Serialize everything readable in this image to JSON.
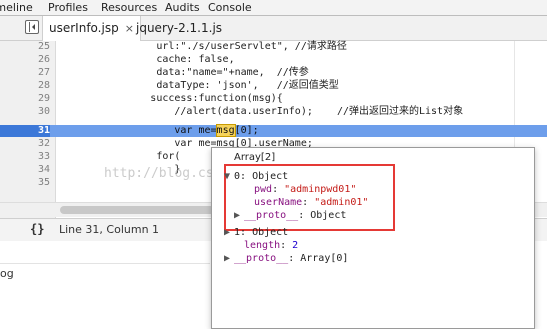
{
  "menu": [
    "Timeline",
    "Profiles",
    "Resources",
    "Audits",
    "Console"
  ],
  "tabs": [
    {
      "label": "userInfo.jsp",
      "close": "×",
      "active": true
    },
    {
      "label": "jquery-2.1.1.js",
      "active": false
    }
  ],
  "code_lines": [
    {
      "num": "25",
      "text": "                url:\"./s/userServlet\", //请求路径"
    },
    {
      "num": "26",
      "text": "                cache: false,"
    },
    {
      "num": "27",
      "text": "                data:\"name=\"+name,  //传参"
    },
    {
      "num": "28",
      "text": "                dataType: 'json',   //返回值类型"
    },
    {
      "num": "29",
      "text": "               success:function(msg){"
    },
    {
      "num": "30",
      "text": "                   //alert(data.userInfo);    //弹出返回过来的List对象"
    },
    {
      "num": "31",
      "text_before": "                   var me=",
      "highlight": "msg",
      "text_after": "[0];"
    },
    {
      "num": "32",
      "text": "                   var me=msg[0].userName;"
    },
    {
      "num": "33",
      "text": "                for("
    },
    {
      "num": "34",
      "text": "                   }"
    },
    {
      "num": "35",
      "text": ""
    }
  ],
  "status": {
    "braces": "{}",
    "position": "Line 31, Column 1"
  },
  "console": {
    "text": "og"
  },
  "popover": {
    "title": "Array[2]",
    "lines": [
      {
        "indent": 0,
        "caret": "▼",
        "key": "0",
        "sep": ": ",
        "value": "Object",
        "vtype": "plain"
      },
      {
        "indent": 2,
        "caret": "",
        "key": "pwd",
        "sep": ": ",
        "value": "\"adminpwd01\"",
        "vtype": "str"
      },
      {
        "indent": 2,
        "caret": "",
        "key": "userName",
        "sep": ": ",
        "value": "\"admin01\"",
        "vtype": "str"
      },
      {
        "indent": 1,
        "caret": "▶",
        "key": "__proto__",
        "sep": ": ",
        "value": "Object",
        "vtype": "plain"
      },
      {
        "indent": 0,
        "caret": "▶",
        "key": "1",
        "sep": ": ",
        "value": "Object",
        "vtype": "plain"
      },
      {
        "indent": 1,
        "caret": "",
        "key": "length",
        "sep": ": ",
        "value": "2",
        "vtype": "num"
      },
      {
        "indent": 0,
        "caret": "▶",
        "key": "__proto__",
        "sep": ": ",
        "value": "Array[0]",
        "vtype": "plain"
      }
    ]
  },
  "watermark": "http://blog.csdn.net/liunian02050328",
  "colors": {
    "line_highlight": "#6d9eeb",
    "annotation_box": "#e53935",
    "string_value": "#c41a16"
  }
}
